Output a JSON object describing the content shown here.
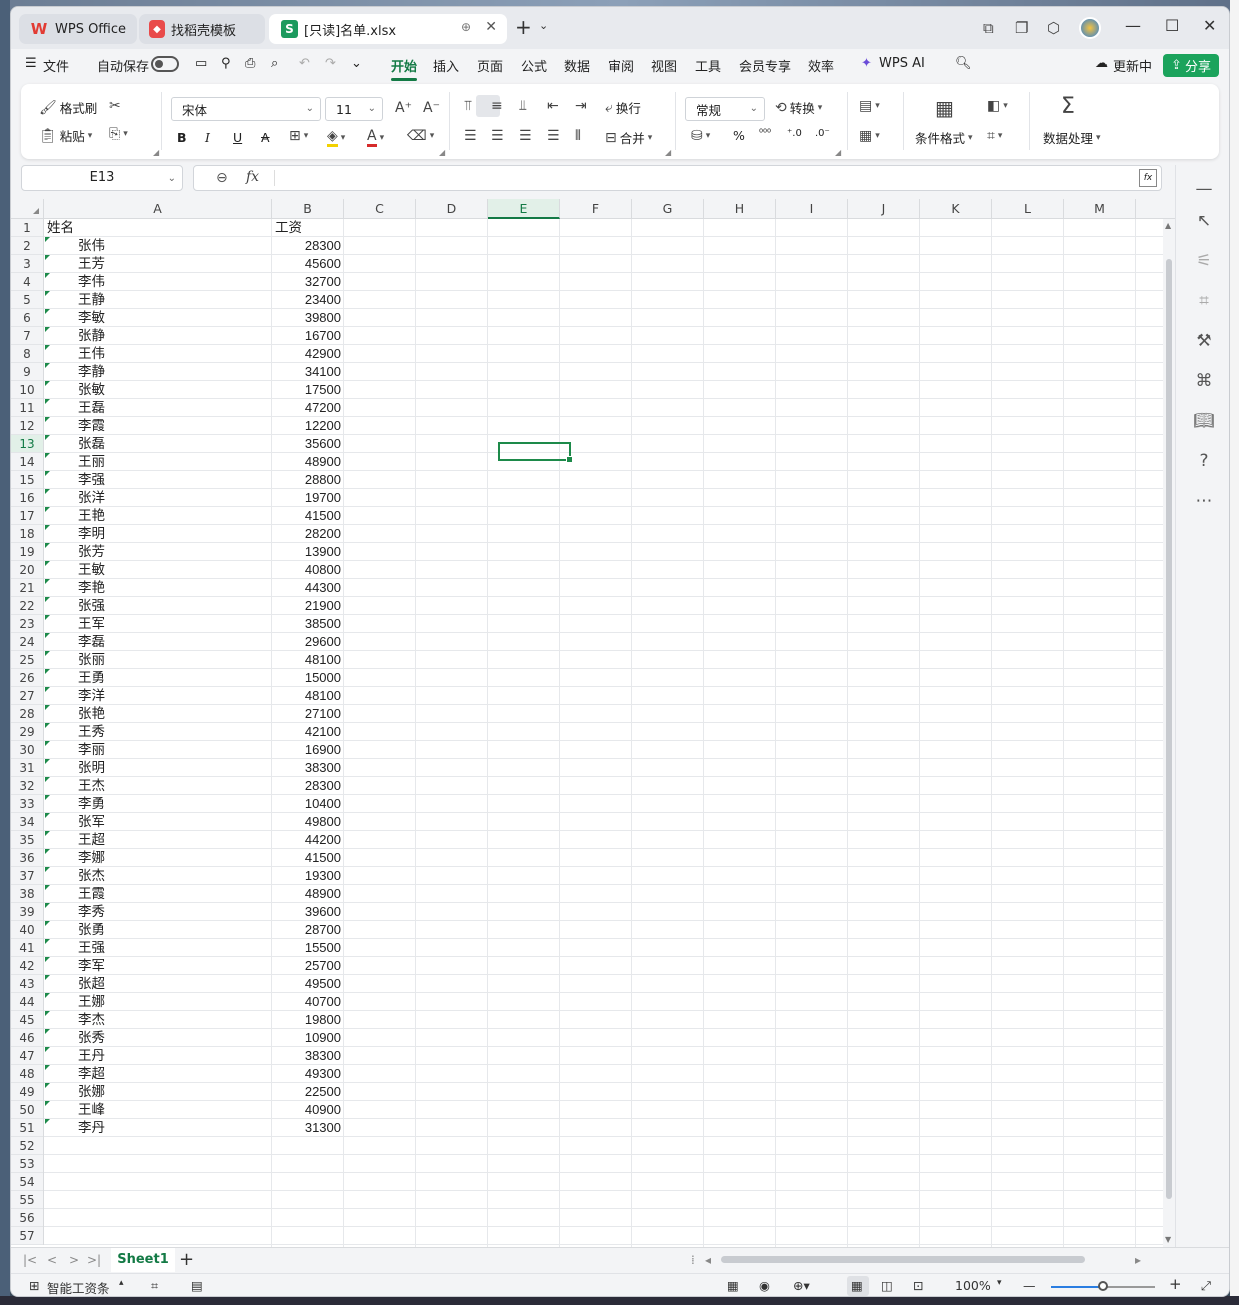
{
  "window": {
    "tabs": [
      {
        "label": "WPS Office"
      },
      {
        "label": "找稻壳模板"
      },
      {
        "label": "[只读]名单.xlsx"
      }
    ]
  },
  "menu": {
    "file": "文件",
    "autosave": "自动保存",
    "items": [
      "开始",
      "插入",
      "页面",
      "公式",
      "数据",
      "审阅",
      "视图",
      "工具",
      "会员专享",
      "效率"
    ],
    "active": "开始",
    "wps_ai": "WPS AI",
    "update": "更新中",
    "share": "分享"
  },
  "ribbon": {
    "format_painter": "格式刷",
    "paste": "粘贴",
    "font_name": "宋体",
    "font_size": "11",
    "bold": "B",
    "italic": "I",
    "underline": "U",
    "strike": "A",
    "wrap": "换行",
    "merge": "合并",
    "number_format": "常规",
    "convert": "转换",
    "percent": "%",
    "conditional_format": "条件格式",
    "data_processing": "数据处理"
  },
  "formula_bar": {
    "name_box": "E13",
    "fx": "fx",
    "value": ""
  },
  "sheet": {
    "columns": [
      "A",
      "B",
      "C",
      "D",
      "E",
      "F",
      "G",
      "H",
      "I",
      "J",
      "K",
      "L",
      "M"
    ],
    "selected_column": "E",
    "selected_row": 13,
    "header": {
      "name": "姓名",
      "salary": "工资"
    },
    "rows": [
      {
        "name": "张伟",
        "salary": "28300"
      },
      {
        "name": "王芳",
        "salary": "45600"
      },
      {
        "name": "李伟",
        "salary": "32700"
      },
      {
        "name": "王静",
        "salary": "23400"
      },
      {
        "name": "李敏",
        "salary": "39800"
      },
      {
        "name": "张静",
        "salary": "16700"
      },
      {
        "name": "王伟",
        "salary": "42900"
      },
      {
        "name": "李静",
        "salary": "34100"
      },
      {
        "name": "张敏",
        "salary": "17500"
      },
      {
        "name": "王磊",
        "salary": "47200"
      },
      {
        "name": "李霞",
        "salary": "12200"
      },
      {
        "name": "张磊",
        "salary": "35600"
      },
      {
        "name": "王丽",
        "salary": "48900"
      },
      {
        "name": "李强",
        "salary": "28800"
      },
      {
        "name": "张洋",
        "salary": "19700"
      },
      {
        "name": "王艳",
        "salary": "41500"
      },
      {
        "name": "李明",
        "salary": "28200"
      },
      {
        "name": "张芳",
        "salary": "13900"
      },
      {
        "name": "王敏",
        "salary": "40800"
      },
      {
        "name": "李艳",
        "salary": "44300"
      },
      {
        "name": "张强",
        "salary": "21900"
      },
      {
        "name": "王军",
        "salary": "38500"
      },
      {
        "name": "李磊",
        "salary": "29600"
      },
      {
        "name": "张丽",
        "salary": "48100"
      },
      {
        "name": "王勇",
        "salary": "15000"
      },
      {
        "name": "李洋",
        "salary": "48100"
      },
      {
        "name": "张艳",
        "salary": "27100"
      },
      {
        "name": "王秀",
        "salary": "42100"
      },
      {
        "name": "李丽",
        "salary": "16900"
      },
      {
        "name": "张明",
        "salary": "38300"
      },
      {
        "name": "王杰",
        "salary": "28300"
      },
      {
        "name": "李勇",
        "salary": "10400"
      },
      {
        "name": "张军",
        "salary": "49800"
      },
      {
        "name": "王超",
        "salary": "44200"
      },
      {
        "name": "李娜",
        "salary": "41500"
      },
      {
        "name": "张杰",
        "salary": "19300"
      },
      {
        "name": "王霞",
        "salary": "48900"
      },
      {
        "name": "李秀",
        "salary": "39600"
      },
      {
        "name": "张勇",
        "salary": "28700"
      },
      {
        "name": "王强",
        "salary": "15500"
      },
      {
        "name": "李军",
        "salary": "25700"
      },
      {
        "name": "张超",
        "salary": "49500"
      },
      {
        "name": "王娜",
        "salary": "40700"
      },
      {
        "name": "李杰",
        "salary": "19800"
      },
      {
        "name": "张秀",
        "salary": "10900"
      },
      {
        "name": "王丹",
        "salary": "38300"
      },
      {
        "name": "李超",
        "salary": "49300"
      },
      {
        "name": "张娜",
        "salary": "22500"
      },
      {
        "name": "王峰",
        "salary": "40900"
      },
      {
        "name": "李丹",
        "salary": "31300"
      }
    ],
    "total_visible_rows": 57
  },
  "sheet_tabs": {
    "active": "Sheet1"
  },
  "status": {
    "smart_salary": "智能工资条",
    "zoom": "100%",
    "zoom_level_percent": 50
  },
  "colors": {
    "accent": "#137a45",
    "share": "#1ba35c",
    "selection": "#1d8a4a"
  }
}
